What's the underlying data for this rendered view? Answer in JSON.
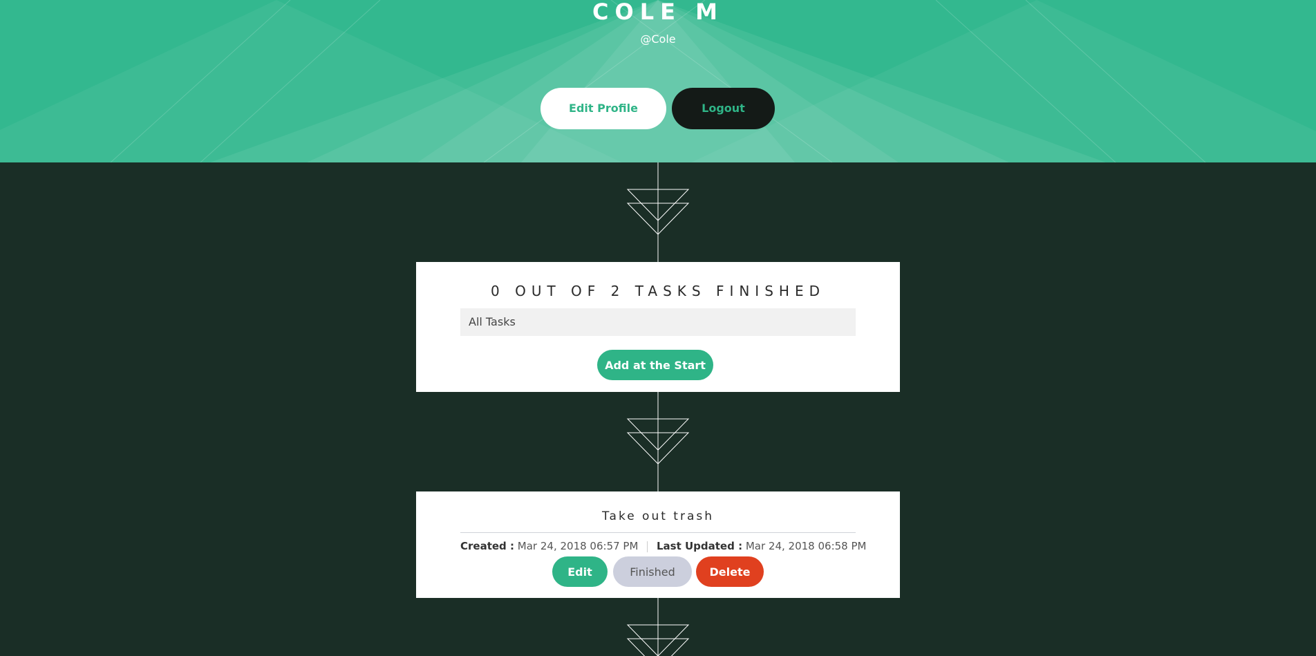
{
  "profile": {
    "name": "COLE M",
    "handle": "@Cole",
    "edit_profile_label": "Edit Profile",
    "logout_label": "Logout"
  },
  "summary": {
    "title": "0 OUT OF 2 TASKS FINISHED",
    "filter_selected": "All Tasks",
    "add_start_label": "Add at the Start"
  },
  "task": {
    "title": "Take out trash",
    "created_label": "Created :",
    "created_value": "Mar 24, 2018 06:57 PM",
    "updated_label": "Last Updated :",
    "updated_value": "Mar 24, 2018 06:58 PM",
    "edit_label": "Edit",
    "finished_label": "Finished",
    "delete_label": "Delete"
  },
  "colors": {
    "hero_green": "#33b88f",
    "page_dark": "#1a2e26",
    "accent_green": "#2fb487",
    "delete_red": "#e0401f",
    "finished_gray": "#cccfdd"
  }
}
